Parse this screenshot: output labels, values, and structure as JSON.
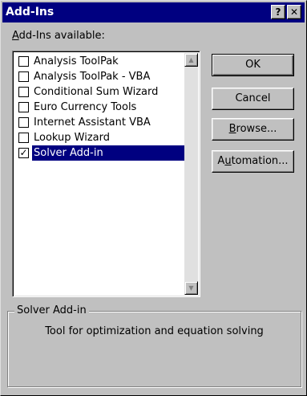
{
  "window": {
    "title": "Add-Ins",
    "help_glyph": "?",
    "close_glyph": "✕"
  },
  "available_label": "Add-Ins available:",
  "addins": [
    {
      "label": "Analysis ToolPak",
      "checked": false,
      "selected": false
    },
    {
      "label": "Analysis ToolPak - VBA",
      "checked": false,
      "selected": false
    },
    {
      "label": "Conditional Sum Wizard",
      "checked": false,
      "selected": false
    },
    {
      "label": "Euro Currency Tools",
      "checked": false,
      "selected": false
    },
    {
      "label": "Internet Assistant VBA",
      "checked": false,
      "selected": false
    },
    {
      "label": "Lookup Wizard",
      "checked": false,
      "selected": false
    },
    {
      "label": "Solver Add-in",
      "checked": true,
      "selected": true
    }
  ],
  "buttons": {
    "ok": "OK",
    "cancel": "Cancel",
    "browse": "Browse...",
    "automation": "Automation..."
  },
  "description": {
    "title": "Solver Add-in",
    "text": "Tool for optimization and equation solving"
  },
  "colors": {
    "titlebar": "#000080",
    "face": "#c0c0c0",
    "selection": "#000080"
  }
}
